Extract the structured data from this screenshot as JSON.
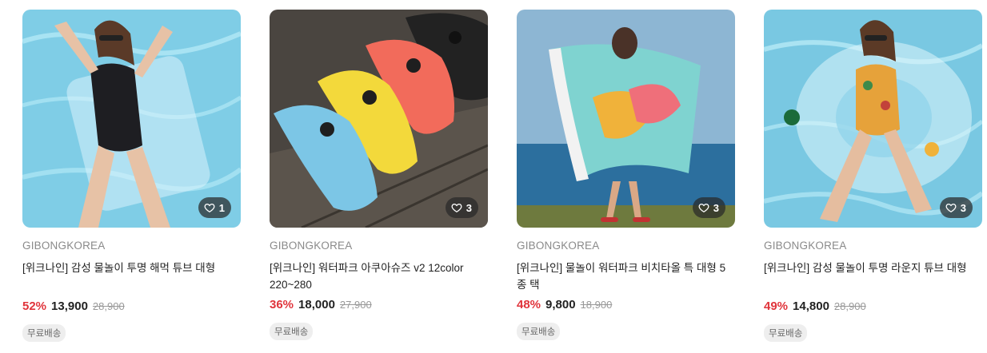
{
  "products": [
    {
      "brand": "GIBONGKOREA",
      "title": "[위크나인] 감성 물놀이 투명 해먹 튜브 대형",
      "discount": "52%",
      "price": "13,900",
      "original_price": "28,900",
      "likes": "1",
      "badge": "무료배송",
      "image_icon": "photo-swimsuit-hammock"
    },
    {
      "brand": "GIBONGKOREA",
      "title": "[위크나인] 워터파크 아쿠아슈즈 v2 12color 220~280",
      "discount": "36%",
      "price": "18,000",
      "original_price": "27,900",
      "likes": "3",
      "badge": "무료배송",
      "image_icon": "photo-aqua-shoes"
    },
    {
      "brand": "GIBONGKOREA",
      "title": "[위크나인] 물놀이 워터파크 비치타올 특 대형 5종 택",
      "discount": "48%",
      "price": "9,800",
      "original_price": "18,900",
      "likes": "3",
      "badge": "무료배송",
      "image_icon": "photo-beach-towel"
    },
    {
      "brand": "GIBONGKOREA",
      "title": "[위크나인] 감성 물놀이 투명 라운지 튜브 대형",
      "discount": "49%",
      "price": "14,800",
      "original_price": "28,900",
      "likes": "3",
      "badge": "무료배송",
      "image_icon": "photo-lounge-tube"
    }
  ],
  "colors": {
    "discount": "#e0343b",
    "pool": "#6ec3de",
    "sea": "#2c6f9e"
  }
}
